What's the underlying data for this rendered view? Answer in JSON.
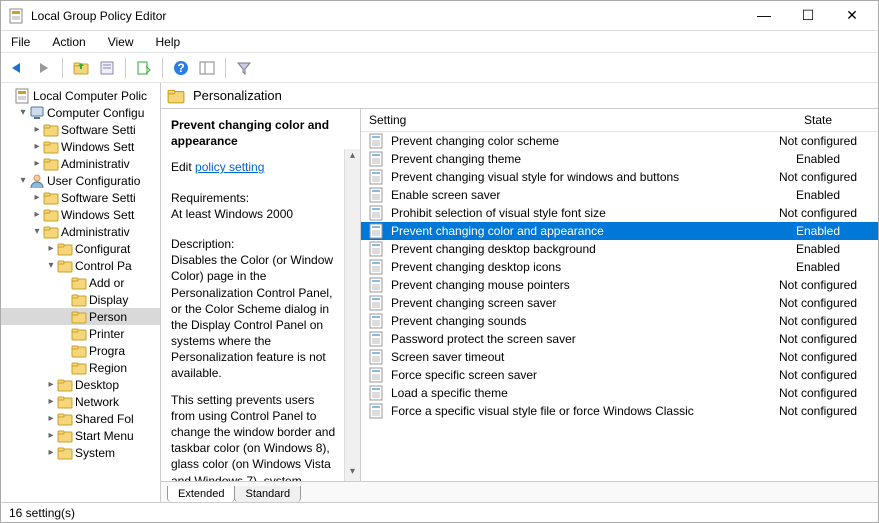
{
  "window": {
    "title": "Local Group Policy Editor"
  },
  "menu": {
    "items": [
      "File",
      "Action",
      "View",
      "Help"
    ]
  },
  "toolbar": {
    "icons": [
      "back",
      "forward",
      "up-folder",
      "props",
      "refresh",
      "help",
      "columns",
      "filter"
    ]
  },
  "tree": {
    "rows": [
      {
        "indent": 0,
        "twisty": "",
        "icon": "root",
        "label": "Local Computer Polic",
        "sel": false
      },
      {
        "indent": 1,
        "twisty": "▾",
        "icon": "comp",
        "label": "Computer Configu",
        "sel": false
      },
      {
        "indent": 2,
        "twisty": "▸",
        "icon": "folder",
        "label": "Software Setti",
        "sel": false
      },
      {
        "indent": 2,
        "twisty": "▸",
        "icon": "folder",
        "label": "Windows Sett",
        "sel": false
      },
      {
        "indent": 2,
        "twisty": "▸",
        "icon": "folder",
        "label": "Administrativ",
        "sel": false
      },
      {
        "indent": 1,
        "twisty": "▾",
        "icon": "user",
        "label": "User Configuratio",
        "sel": false
      },
      {
        "indent": 2,
        "twisty": "▸",
        "icon": "folder",
        "label": "Software Setti",
        "sel": false
      },
      {
        "indent": 2,
        "twisty": "▸",
        "icon": "folder",
        "label": "Windows Sett",
        "sel": false
      },
      {
        "indent": 2,
        "twisty": "▾",
        "icon": "folder",
        "label": "Administrativ",
        "sel": false
      },
      {
        "indent": 3,
        "twisty": "▸",
        "icon": "folder",
        "label": "Configurat",
        "sel": false
      },
      {
        "indent": 3,
        "twisty": "▾",
        "icon": "folder",
        "label": "Control Pa",
        "sel": false
      },
      {
        "indent": 4,
        "twisty": "",
        "icon": "folder",
        "label": "Add or",
        "sel": false
      },
      {
        "indent": 4,
        "twisty": "",
        "icon": "folder",
        "label": "Display",
        "sel": false
      },
      {
        "indent": 4,
        "twisty": "",
        "icon": "folder",
        "label": "Person",
        "sel": true
      },
      {
        "indent": 4,
        "twisty": "",
        "icon": "folder",
        "label": "Printer",
        "sel": false
      },
      {
        "indent": 4,
        "twisty": "",
        "icon": "folder",
        "label": "Progra",
        "sel": false
      },
      {
        "indent": 4,
        "twisty": "",
        "icon": "folder",
        "label": "Region",
        "sel": false
      },
      {
        "indent": 3,
        "twisty": "▸",
        "icon": "folder",
        "label": "Desktop",
        "sel": false
      },
      {
        "indent": 3,
        "twisty": "▸",
        "icon": "folder",
        "label": "Network",
        "sel": false
      },
      {
        "indent": 3,
        "twisty": "▸",
        "icon": "folder",
        "label": "Shared Fol",
        "sel": false
      },
      {
        "indent": 3,
        "twisty": "▸",
        "icon": "folder",
        "label": "Start Menu",
        "sel": false
      },
      {
        "indent": 3,
        "twisty": "▸",
        "icon": "folder",
        "label": "System",
        "sel": false
      }
    ]
  },
  "header": {
    "path": "Personalization"
  },
  "detail": {
    "title": "Prevent changing color and appearance",
    "edit_prefix": "Edit ",
    "edit_link": "policy setting",
    "req_label": "Requirements:",
    "req_value": "At least Windows 2000",
    "desc_label": "Description:",
    "desc_p1": "Disables the Color (or Window Color) page in the Personalization Control Panel, or the Color Scheme dialog in the Display Control Panel on systems where the Personalization feature is not available.",
    "desc_p2": "This setting prevents users from using Control Panel to change the window border and taskbar color (on Windows 8), glass color (on Windows Vista and Windows 7), system colors, or color scheme of the desktop and windows."
  },
  "columns": {
    "setting": "Setting",
    "state": "State"
  },
  "settings": [
    {
      "name": "Prevent changing color scheme",
      "state": "Not configured",
      "sel": false
    },
    {
      "name": "Prevent changing theme",
      "state": "Enabled",
      "sel": false
    },
    {
      "name": "Prevent changing visual style for windows and buttons",
      "state": "Not configured",
      "sel": false
    },
    {
      "name": "Enable screen saver",
      "state": "Enabled",
      "sel": false
    },
    {
      "name": "Prohibit selection of visual style font size",
      "state": "Not configured",
      "sel": false
    },
    {
      "name": "Prevent changing color and appearance",
      "state": "Enabled",
      "sel": true
    },
    {
      "name": "Prevent changing desktop background",
      "state": "Enabled",
      "sel": false
    },
    {
      "name": "Prevent changing desktop icons",
      "state": "Enabled",
      "sel": false
    },
    {
      "name": "Prevent changing mouse pointers",
      "state": "Not configured",
      "sel": false
    },
    {
      "name": "Prevent changing screen saver",
      "state": "Not configured",
      "sel": false
    },
    {
      "name": "Prevent changing sounds",
      "state": "Not configured",
      "sel": false
    },
    {
      "name": "Password protect the screen saver",
      "state": "Not configured",
      "sel": false
    },
    {
      "name": "Screen saver timeout",
      "state": "Not configured",
      "sel": false
    },
    {
      "name": "Force specific screen saver",
      "state": "Not configured",
      "sel": false
    },
    {
      "name": "Load a specific theme",
      "state": "Not configured",
      "sel": false
    },
    {
      "name": "Force a specific visual style file or force Windows Classic",
      "state": "Not configured",
      "sel": false
    }
  ],
  "tabs": {
    "extended": "Extended",
    "standard": "Standard"
  },
  "status": {
    "text": "16 setting(s)"
  }
}
